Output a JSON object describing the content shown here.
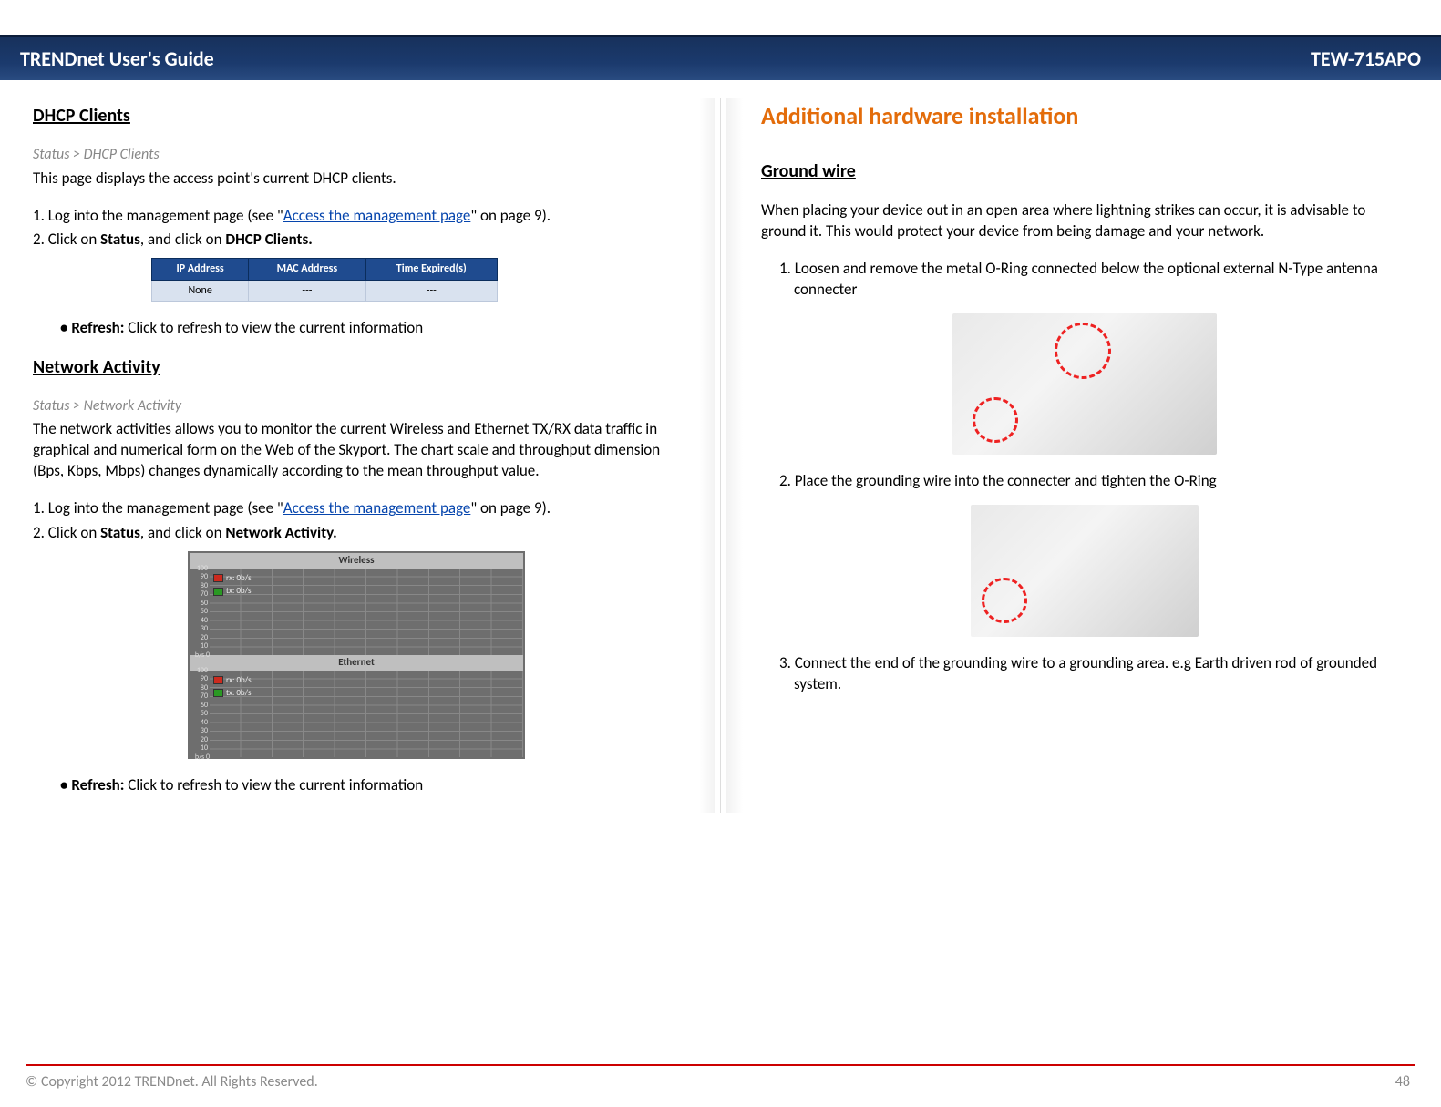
{
  "header": {
    "left": "TRENDnet User's Guide",
    "right": "TEW-715APO"
  },
  "left": {
    "dhcp": {
      "title": "DHCP Clients",
      "breadcrumb": "Status > DHCP Clients",
      "intro": "This page displays the access point's current DHCP clients.",
      "step1_pre": "1. Log into the management page (see \"",
      "step1_link": "Access the management page",
      "step1_post": "\" on page 9).",
      "step2_pre": "2. Click on ",
      "step2_b1": "Status",
      "step2_mid": ", and click on ",
      "step2_b2": "DHCP Clients.",
      "table": {
        "headers": [
          "IP Address",
          "MAC Address",
          "Time Expired(s)"
        ],
        "row": [
          "None",
          "---",
          "---"
        ]
      },
      "refresh_label": "Refresh:",
      "refresh_text": " Click to refresh to view the current information"
    },
    "network": {
      "title": "Network Activity",
      "breadcrumb": "Status > Network Activity",
      "intro": "The network activities allows you to monitor the current Wireless and Ethernet TX/RX data traffic in graphical and numerical form on the Web of the Skyport.  The chart scale and throughput dimension (Bps, Kbps, Mbps) changes dynamically according to the mean throughput value.",
      "step1_pre": "1. Log into the management page (see \"",
      "step1_link": "Access the management page",
      "step1_post": "\" on page 9).",
      "step2_pre": "2. Click on ",
      "step2_b1": "Status",
      "step2_mid": ", and click on ",
      "step2_b2": "Network Activity.",
      "chart": {
        "top_title": "Wireless",
        "bottom_title": "Ethernet",
        "y_ticks": [
          "100",
          "90",
          "80",
          "70",
          "60",
          "50",
          "40",
          "30",
          "20",
          "10"
        ],
        "y_unit": "b/s 0",
        "legend_rx": "rx: 0b/s",
        "legend_tx": "tx: 0b/s"
      },
      "refresh_label": "Refresh:",
      "refresh_text": " Click to refresh to view the current information"
    }
  },
  "right": {
    "title": "Additional hardware installation",
    "ground": {
      "title": "Ground wire",
      "intro": "When placing your device out in an open area where lightning strikes can occur, it is advisable to ground it. This would protect your device from being damage and your network.",
      "step1": "1. Loosen and remove the metal O-Ring connected below the optional external N-Type antenna connecter",
      "step2": "2. Place the grounding wire into the connecter and tighten the O-Ring",
      "step3": "3. Connect the end of the grounding wire to a grounding area. e.g Earth driven rod of grounded system."
    }
  },
  "footer": {
    "copyright": "© Copyright 2012 TRENDnet. All Rights Reserved.",
    "page": "48"
  },
  "chart_data": [
    {
      "type": "line",
      "title": "Wireless",
      "series": [
        {
          "name": "rx",
          "values": [
            0
          ],
          "unit": "b/s",
          "legend": "rx: 0b/s"
        },
        {
          "name": "tx",
          "values": [
            0
          ],
          "unit": "b/s",
          "legend": "tx: 0b/s"
        }
      ],
      "y_ticks": [
        0,
        10,
        20,
        30,
        40,
        50,
        60,
        70,
        80,
        90,
        100
      ],
      "ylabel": "b/s",
      "ylim": [
        0,
        100
      ]
    },
    {
      "type": "line",
      "title": "Ethernet",
      "series": [
        {
          "name": "rx",
          "values": [
            0
          ],
          "unit": "b/s",
          "legend": "rx: 0b/s"
        },
        {
          "name": "tx",
          "values": [
            0
          ],
          "unit": "b/s",
          "legend": "tx: 0b/s"
        }
      ],
      "y_ticks": [
        0,
        10,
        20,
        30,
        40,
        50,
        60,
        70,
        80,
        90,
        100
      ],
      "ylabel": "b/s",
      "ylim": [
        0,
        100
      ]
    }
  ]
}
